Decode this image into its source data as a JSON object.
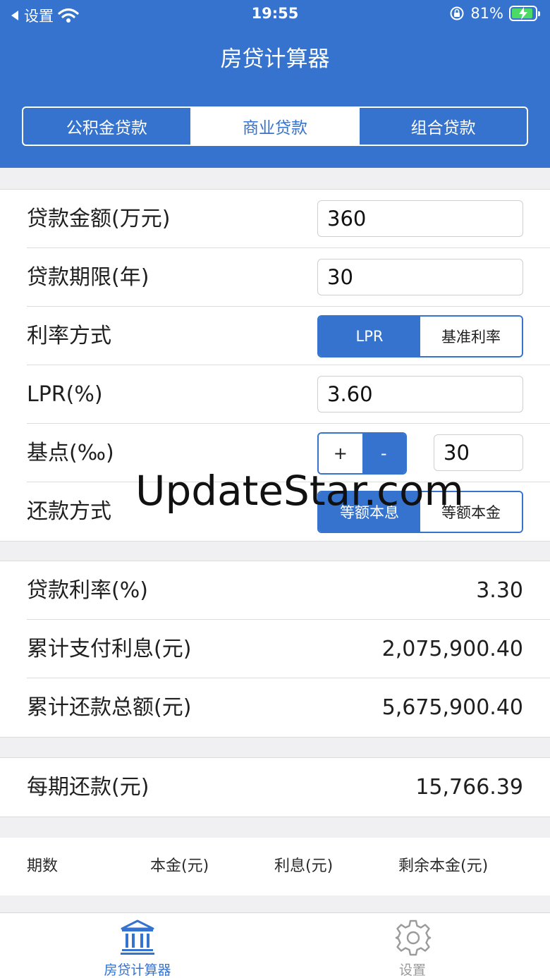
{
  "status_bar": {
    "back_label": "设置",
    "time": "19:55",
    "battery": "81%",
    "battery_level": 0.81
  },
  "nav": {
    "title": "房贷计算器"
  },
  "loan_types": [
    {
      "label": "公积金贷款",
      "active": false
    },
    {
      "label": "商业贷款",
      "active": true
    },
    {
      "label": "组合贷款",
      "active": false
    }
  ],
  "form": {
    "amount_label": "贷款金额(万元)",
    "amount_value": "360",
    "term_label": "贷款期限(年)",
    "term_value": "30",
    "rate_mode_label": "利率方式",
    "rate_mode_options": [
      "LPR",
      "基准利率"
    ],
    "lpr_label": "LPR(%)",
    "lpr_value": "3.60",
    "bp_label": "基点(‰)",
    "bp_plus": "+",
    "bp_minus": "-",
    "bp_value": "30",
    "repay_label": "还款方式",
    "repay_options": [
      "等额本息",
      "等额本金"
    ]
  },
  "results": {
    "rate_label": "贷款利率(%)",
    "rate_value": "3.30",
    "interest_label": "累计支付利息(元)",
    "interest_value": "2,075,900.40",
    "total_label": "累计还款总额(元)",
    "total_value": "5,675,900.40"
  },
  "monthly": {
    "label": "每期还款(元)",
    "value": "15,766.39"
  },
  "table": {
    "columns": [
      "期数",
      "本金(元)",
      "利息(元)",
      "剩余本金(元)"
    ]
  },
  "watermark": "UpdateStar.com",
  "tabs": [
    {
      "label": "房贷计算器",
      "icon": "bank-icon",
      "active": true
    },
    {
      "label": "设置",
      "icon": "gear-icon",
      "active": false
    }
  ],
  "colors": {
    "primary": "#3573cf",
    "inactive": "#9a9a9a"
  }
}
